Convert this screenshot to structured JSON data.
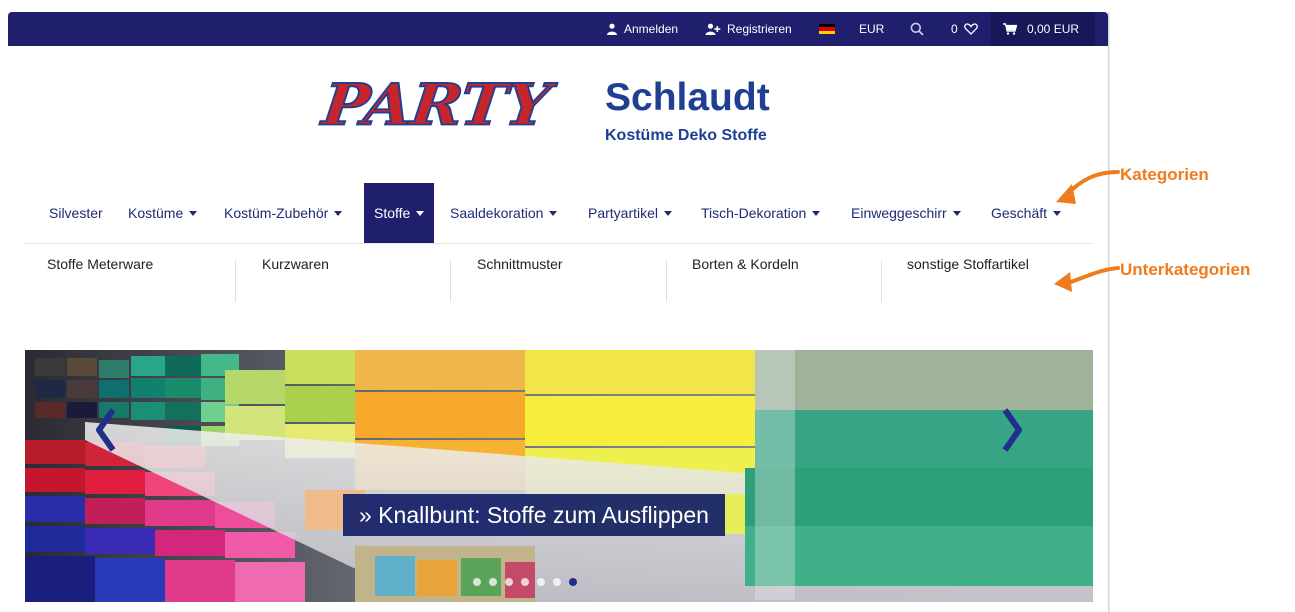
{
  "topbar": {
    "login_label": "Anmelden",
    "register_label": "Registrieren",
    "currency": "EUR",
    "wishlist_count": "0",
    "cart_total": "0,00 EUR"
  },
  "logo": {
    "party": "PARTY",
    "name": "Schlaudt",
    "tagline": "Kostüme Deko Stoffe"
  },
  "categories": [
    {
      "label": "Silvester"
    },
    {
      "label": "Kostüme"
    },
    {
      "label": "Kostüm-Zubehör"
    },
    {
      "label": "Stoffe"
    },
    {
      "label": "Saaldekoration"
    },
    {
      "label": "Partyartikel"
    },
    {
      "label": "Tisch-Dekoration"
    },
    {
      "label": "Einweggeschirr"
    },
    {
      "label": "Geschäft"
    }
  ],
  "subcategories": [
    {
      "label": "Stoffe Meterware"
    },
    {
      "label": "Kurzwaren"
    },
    {
      "label": "Schnittmuster"
    },
    {
      "label": "Borten & Kordeln"
    },
    {
      "label": "sonstige Stoffartikel"
    }
  ],
  "slider": {
    "caption": "» Knallbunt: Stoffe zum Ausflippen"
  },
  "annotations": {
    "categories": "Kategorien",
    "subcategories": "Unterkategorien"
  },
  "colors": {
    "primary": "#1f1f6e",
    "annotation": "#f07b1c",
    "logo_red": "#c6262b",
    "logo_blue": "#1e3f92"
  }
}
